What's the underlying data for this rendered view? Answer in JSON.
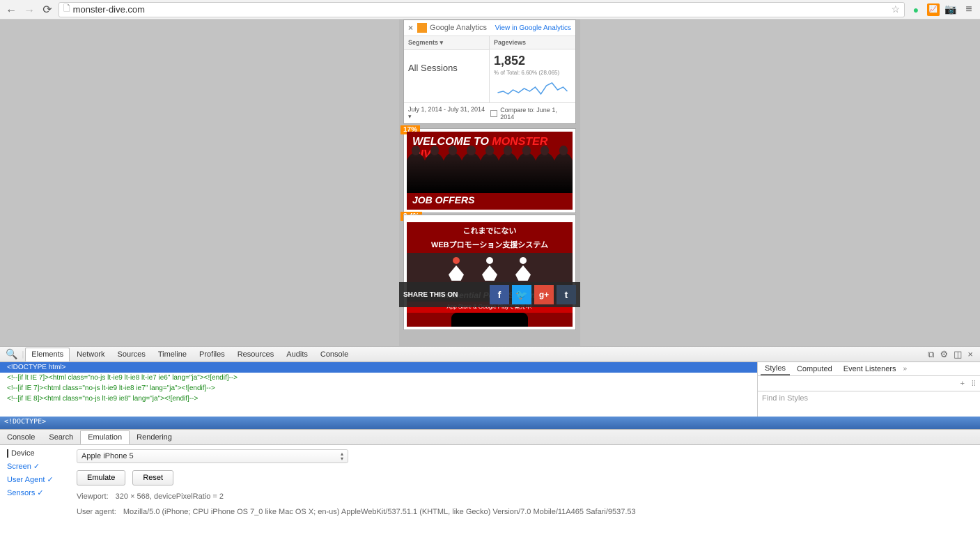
{
  "browser": {
    "url": "monster-dive.com"
  },
  "ga": {
    "brand": "Google Analytics",
    "view_link": "View in Google Analytics",
    "segments_label": "Segments",
    "pageviews_label": "Pageviews",
    "sessions_label": "All Sessions",
    "pageviews_value": "1,852",
    "pageviews_sub": "% of Total: 6.60% (28,065)",
    "date_range": "July 1, 2014 - July 31, 2014",
    "compare_label": "Compare to: June 1, 2014"
  },
  "page": {
    "badge1": "17%",
    "banner1_prefix": "WELCOME TO ",
    "banner1_brand": "MONSTER DIVE",
    "banner1_sub": "JOB OFFERS",
    "badge2": "2.4%",
    "banner2_line1": "これまでにない",
    "banner2_line2": "WEBプロモーション支援システム",
    "ips_text": "Influential PowerSystem",
    "share_label": "SHARE THIS ON",
    "app_strip": "App Store & Google Playで発売中!"
  },
  "devtools": {
    "tabs": [
      "Elements",
      "Network",
      "Sources",
      "Timeline",
      "Profiles",
      "Resources",
      "Audits",
      "Console"
    ],
    "active_tab": "Elements",
    "code": {
      "l1": "<!DOCTYPE html>",
      "l2": "<!--[if lt IE 7]><html class=\"no-js lt-ie9 lt-ie8 lt-ie7 ie6\" lang=\"ja\"><![endif]-->",
      "l3": "<!--[if IE 7]><html class=\"no-js lt-ie9 lt-ie8 ie7\" lang=\"ja\"><![endif]-->",
      "l4": "<!--[if IE 8]><html class=\"no-js lt-ie9 ie8\" lang=\"ja\"><![endif]-->"
    },
    "crumb": "<!DOCTYPE>",
    "styles_tabs": [
      "Styles",
      "Computed",
      "Event Listeners"
    ],
    "find_placeholder": "Find in Styles"
  },
  "drawer": {
    "tabs": [
      "Console",
      "Search",
      "Emulation",
      "Rendering"
    ],
    "active": "Emulation",
    "side": {
      "device": "Device",
      "screen": "Screen",
      "ua": "User Agent",
      "sensors": "Sensors"
    },
    "device_select": "Apple iPhone 5",
    "emulate_btn": "Emulate",
    "reset_btn": "Reset",
    "viewport_label": "Viewport:",
    "viewport_val": "320 × 568, devicePixelRatio = 2",
    "ua_label": "User agent:",
    "ua_val": "Mozilla/5.0 (iPhone; CPU iPhone OS 7_0 like Mac OS X; en-us) AppleWebKit/537.51.1 (KHTML, like Gecko) Version/7.0 Mobile/11A465 Safari/9537.53"
  }
}
